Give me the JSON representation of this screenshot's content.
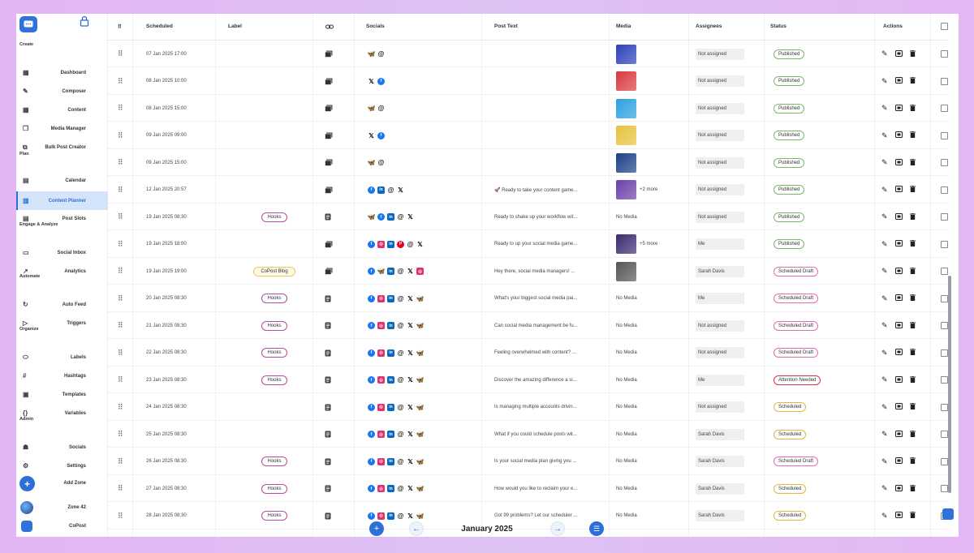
{
  "sidebar": {
    "sections": [
      "Create",
      "Plan",
      "Engage & Analyze",
      "Automate",
      "Organize",
      "Admin"
    ],
    "items": [
      {
        "label": "Dashboard",
        "icon": "dashboard-icon"
      },
      {
        "label": "Composer",
        "icon": "pencil-icon"
      },
      {
        "label": "Content",
        "icon": "grid-icon"
      },
      {
        "label": "Media Manager",
        "icon": "images-icon"
      },
      {
        "label": "Bulk Post Creator",
        "icon": "copy-icon"
      },
      {
        "label": "Calendar",
        "icon": "calendar-icon"
      },
      {
        "label": "Content Planner",
        "icon": "planner-icon",
        "active": true
      },
      {
        "label": "Post Slots",
        "icon": "slots-icon"
      },
      {
        "label": "Social Inbox",
        "icon": "inbox-icon"
      },
      {
        "label": "Analytics",
        "icon": "trend-icon"
      },
      {
        "label": "Auto Feed",
        "icon": "refresh-icon"
      },
      {
        "label": "Triggers",
        "icon": "play-icon"
      },
      {
        "label": "Labels",
        "icon": "tag-icon"
      },
      {
        "label": "Hashtags",
        "icon": "hash-icon"
      },
      {
        "label": "Templates",
        "icon": "template-icon"
      },
      {
        "label": "Variables",
        "icon": "braces-icon"
      },
      {
        "label": "Socials",
        "icon": "people-icon"
      },
      {
        "label": "Settings",
        "icon": "gear-icon"
      }
    ],
    "bottom": {
      "add_zone": "Add Zone",
      "zone": "Zone 42",
      "brand": "CoPost"
    }
  },
  "table": {
    "headers": {
      "scheduled": "Scheduled",
      "label": "Label",
      "socials": "Socials",
      "post_text": "Post Text",
      "media": "Media",
      "assignees": "Assignees",
      "status": "Status",
      "actions": "Actions"
    },
    "rows": [
      {
        "scheduled": "07 Jan 2025 17:00",
        "label": "",
        "type": "gallery",
        "socials": [
          "bs",
          "th"
        ],
        "text": "",
        "media": "thumb",
        "thumb": "#2a3fb8",
        "more": "",
        "assignee": "Not assigned",
        "status": "Published"
      },
      {
        "scheduled": "08 Jan 2025 10:00",
        "label": "",
        "type": "gallery",
        "socials": [
          "x",
          "fb"
        ],
        "text": "",
        "media": "thumb",
        "thumb": "#d9393f",
        "more": "",
        "assignee": "Not assigned",
        "status": "Published"
      },
      {
        "scheduled": "08 Jan 2025 15:00",
        "label": "",
        "type": "gallery",
        "socials": [
          "bs",
          "th"
        ],
        "text": "",
        "media": "thumb",
        "thumb": "#2b9fe0",
        "more": "",
        "assignee": "Not assigned",
        "status": "Published"
      },
      {
        "scheduled": "09 Jan 2025 09:00",
        "label": "",
        "type": "gallery",
        "socials": [
          "x",
          "fb"
        ],
        "text": "",
        "media": "thumb",
        "thumb": "#e6c23a",
        "more": "",
        "assignee": "Not assigned",
        "status": "Published"
      },
      {
        "scheduled": "09 Jan 2025 15:00",
        "label": "",
        "type": "gallery",
        "socials": [
          "bs",
          "th"
        ],
        "text": "",
        "media": "thumb",
        "thumb": "#1b3f86",
        "more": "",
        "assignee": "Not assigned",
        "status": "Published"
      },
      {
        "scheduled": "12 Jan 2025 20:57",
        "label": "",
        "type": "gallery",
        "socials": [
          "fb",
          "li",
          "th",
          "x"
        ],
        "text": "🚀 Ready to take your content game...",
        "media": "thumb",
        "thumb": "#6b3fa8",
        "more": "+2 more",
        "assignee": "Not assigned",
        "status": "Published"
      },
      {
        "scheduled": "19 Jan 2025 08:30",
        "label": "Hooks",
        "type": "doc",
        "socials": [
          "bs",
          "fb",
          "li",
          "th",
          "x"
        ],
        "text": "Ready to shake up your workflow wit...",
        "media": "none",
        "thumb": "",
        "more": "",
        "assignee": "Not assigned",
        "status": "Published"
      },
      {
        "scheduled": "19 Jan 2025 18:00",
        "label": "",
        "type": "gallery",
        "socials": [
          "fb",
          "ig",
          "li",
          "pin",
          "th",
          "x"
        ],
        "text": "Ready to up your social media game...",
        "media": "thumb",
        "thumb": "#3a2a6e",
        "more": "+5 more",
        "assignee": "Me",
        "status": "Published"
      },
      {
        "scheduled": "19 Jan 2025 19:00",
        "label": "CoPost Blog",
        "type": "gallery",
        "socials": [
          "fb",
          "bs",
          "li",
          "th",
          "x",
          "ig"
        ],
        "text": "Hey there, social media managers! ...",
        "media": "thumb",
        "thumb": "#555555",
        "more": "",
        "assignee": "Sarah Davis",
        "status": "Scheduled Draft"
      },
      {
        "scheduled": "20 Jan 2025 08:30",
        "label": "Hooks",
        "type": "doc",
        "socials": [
          "fb",
          "ig",
          "li",
          "th",
          "x",
          "bs"
        ],
        "text": "What's your biggest social media pai...",
        "media": "none",
        "thumb": "",
        "more": "",
        "assignee": "Me",
        "status": "Scheduled Draft"
      },
      {
        "scheduled": "21 Jan 2025 08:30",
        "label": "Hooks",
        "type": "doc",
        "socials": [
          "fb",
          "ig",
          "li",
          "th",
          "x",
          "bs"
        ],
        "text": "Can social media management be fu...",
        "media": "none",
        "thumb": "",
        "more": "",
        "assignee": "Not assigned",
        "status": "Scheduled Draft"
      },
      {
        "scheduled": "22 Jan 2025 08:30",
        "label": "Hooks",
        "type": "doc",
        "socials": [
          "fb",
          "ig",
          "li",
          "th",
          "x",
          "bs"
        ],
        "text": "Feeling overwhelmed with content? ...",
        "media": "none",
        "thumb": "",
        "more": "",
        "assignee": "Not assigned",
        "status": "Scheduled Draft"
      },
      {
        "scheduled": "23 Jan 2025 08:30",
        "label": "Hooks",
        "type": "doc",
        "socials": [
          "fb",
          "ig",
          "li",
          "th",
          "x",
          "bs"
        ],
        "text": "Discover the amazing difference a si...",
        "media": "none",
        "thumb": "",
        "more": "",
        "assignee": "Me",
        "status": "Attention Needed"
      },
      {
        "scheduled": "24 Jan 2025 08:30",
        "label": "",
        "type": "doc",
        "socials": [
          "fb",
          "ig",
          "li",
          "th",
          "x",
          "bs"
        ],
        "text": "Is managing multiple accounts drivin...",
        "media": "none",
        "thumb": "",
        "more": "",
        "assignee": "Not assigned",
        "status": "Scheduled"
      },
      {
        "scheduled": "25 Jan 2025 08:30",
        "label": "",
        "type": "doc",
        "socials": [
          "fb",
          "ig",
          "li",
          "th",
          "x",
          "bs"
        ],
        "text": "What if you could schedule posts wit...",
        "media": "none",
        "thumb": "",
        "more": "",
        "assignee": "Sarah Davis",
        "status": "Scheduled"
      },
      {
        "scheduled": "26 Jan 2025 08:30",
        "label": "Hooks",
        "type": "doc",
        "socials": [
          "fb",
          "ig",
          "li",
          "th",
          "x",
          "bs"
        ],
        "text": "Is your social media plan giving you ...",
        "media": "none",
        "thumb": "",
        "more": "",
        "assignee": "Sarah Davis",
        "status": "Scheduled Draft"
      },
      {
        "scheduled": "27 Jan 2025 08:30",
        "label": "Hooks",
        "type": "doc",
        "socials": [
          "fb",
          "ig",
          "li",
          "th",
          "x",
          "bs"
        ],
        "text": "How would you like to reclaim your e...",
        "media": "none",
        "thumb": "",
        "more": "",
        "assignee": "Sarah Davis",
        "status": "Scheduled"
      },
      {
        "scheduled": "28 Jan 2025 08:30",
        "label": "Hooks",
        "type": "doc",
        "socials": [
          "fb",
          "ig",
          "li",
          "th",
          "x",
          "bs"
        ],
        "text": "Got 99 problems? Let our scheduler ...",
        "media": "none",
        "thumb": "",
        "more": "",
        "assignee": "Sarah Davis",
        "status": "Scheduled"
      }
    ],
    "no_media_label": "No Media"
  },
  "pager": {
    "month": "January 2025"
  },
  "colors": {
    "accent": "#2c6fd6",
    "published": "#7cb86c",
    "scheduled_draft": "#e46bb4",
    "attention": "#d9324a",
    "scheduled": "#e7b441"
  }
}
